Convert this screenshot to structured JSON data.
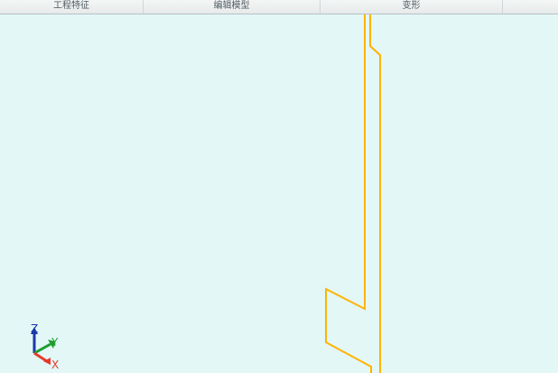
{
  "ribbon": {
    "groups": [
      {
        "label": "工程特征"
      },
      {
        "label": "编辑模型"
      },
      {
        "label": "变形"
      }
    ]
  },
  "viewport": {
    "background_color": "#e3f7f7",
    "profile_color": "#ffb300",
    "triad": {
      "z_label": "Z",
      "y_label": "Y",
      "x_label": "X",
      "z_color": "#1a3aa8",
      "y_color": "#1b9e2f",
      "x_color": "#e53b2c"
    }
  }
}
